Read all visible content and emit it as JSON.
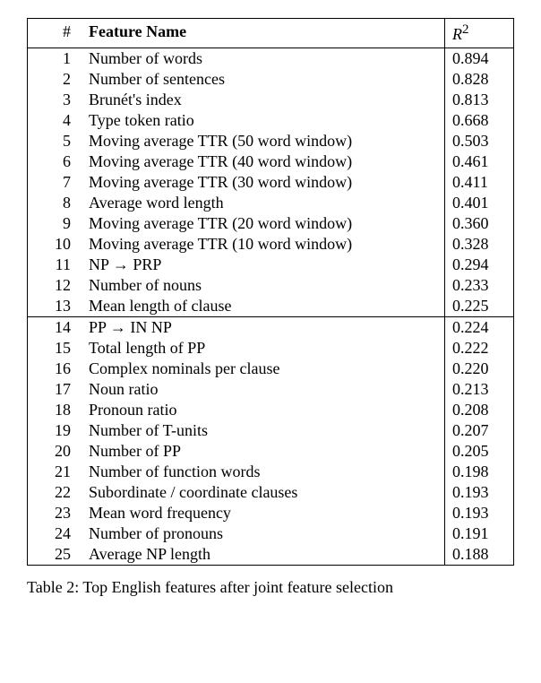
{
  "chart_data": {
    "type": "table",
    "title": "Top English features after joint feature selection",
    "columns": [
      "#",
      "Feature Name",
      "R²"
    ],
    "rows_group1": [
      {
        "num": 1,
        "feat": "Number of words",
        "r2": "0.894"
      },
      {
        "num": 2,
        "feat": "Number of sentences",
        "r2": "0.828"
      },
      {
        "num": 3,
        "feat": "Brunét's index",
        "r2": "0.813"
      },
      {
        "num": 4,
        "feat": "Type token ratio",
        "r2": "0.668"
      },
      {
        "num": 5,
        "feat": "Moving average TTR (50 word window)",
        "r2": "0.503"
      },
      {
        "num": 6,
        "feat": "Moving average TTR (40 word window)",
        "r2": "0.461"
      },
      {
        "num": 7,
        "feat": "Moving average TTR (30 word window)",
        "r2": "0.411"
      },
      {
        "num": 8,
        "feat": "Average word length",
        "r2": "0.401"
      },
      {
        "num": 9,
        "feat": "Moving average TTR (20 word window)",
        "r2": "0.360"
      },
      {
        "num": 10,
        "feat": "Moving average TTR (10 word window)",
        "r2": "0.328"
      },
      {
        "num": 11,
        "feat": "NP → PRP",
        "r2": "0.294"
      },
      {
        "num": 12,
        "feat": "Number of nouns",
        "r2": "0.233"
      },
      {
        "num": 13,
        "feat": "Mean length of clause",
        "r2": "0.225"
      }
    ],
    "rows_group2": [
      {
        "num": 14,
        "feat": "PP → IN NP",
        "r2": "0.224"
      },
      {
        "num": 15,
        "feat": "Total length of PP",
        "r2": "0.222"
      },
      {
        "num": 16,
        "feat": "Complex nominals per clause",
        "r2": "0.220"
      },
      {
        "num": 17,
        "feat": "Noun ratio",
        "r2": "0.213"
      },
      {
        "num": 18,
        "feat": "Pronoun ratio",
        "r2": "0.208"
      },
      {
        "num": 19,
        "feat": "Number of T-units",
        "r2": "0.207"
      },
      {
        "num": 20,
        "feat": "Number of PP",
        "r2": "0.205"
      },
      {
        "num": 21,
        "feat": "Number of function words",
        "r2": "0.198"
      },
      {
        "num": 22,
        "feat": "Subordinate / coordinate clauses",
        "r2": "0.193"
      },
      {
        "num": 23,
        "feat": "Mean word frequency",
        "r2": "0.193"
      },
      {
        "num": 24,
        "feat": "Number of pronouns",
        "r2": "0.191"
      },
      {
        "num": 25,
        "feat": "Average NP length",
        "r2": "0.188"
      }
    ]
  },
  "headers": {
    "num": "#",
    "feat": "Feature Name",
    "r2_sym": "R",
    "r2_sup": "2"
  },
  "caption_prefix": "Table 2: Top English features after joint feature selection"
}
